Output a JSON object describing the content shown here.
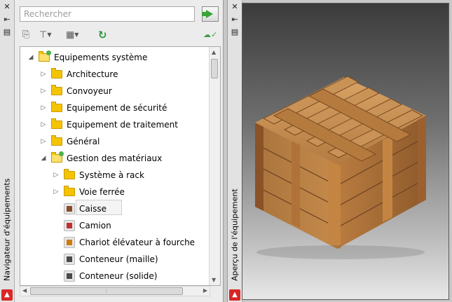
{
  "navigator": {
    "title": "Navigateur d'équipements",
    "search_placeholder": "Rechercher",
    "tree": [
      {
        "label": "Equipements système",
        "kind": "folder-open",
        "expander": "◢",
        "level": 0
      },
      {
        "label": "Architecture",
        "kind": "folder",
        "expander": "▷",
        "level": 1
      },
      {
        "label": "Convoyeur",
        "kind": "folder",
        "expander": "▷",
        "level": 1
      },
      {
        "label": "Equipement de sécurité",
        "kind": "folder",
        "expander": "▷",
        "level": 1
      },
      {
        "label": "Equipement de traitement",
        "kind": "folder",
        "expander": "▷",
        "level": 1
      },
      {
        "label": "Général",
        "kind": "folder",
        "expander": "▷",
        "level": 1
      },
      {
        "label": "Gestion des matériaux",
        "kind": "folder-open",
        "expander": "◢",
        "level": 1
      },
      {
        "label": "Système à rack",
        "kind": "folder",
        "expander": "▷",
        "level": 2
      },
      {
        "label": "Voie ferrée",
        "kind": "folder",
        "expander": "▷",
        "level": 2
      },
      {
        "label": "Caisse",
        "kind": "item",
        "icon_color": "#8a4a2a",
        "level": 2,
        "selected": true
      },
      {
        "label": "Camion",
        "kind": "item",
        "icon_color": "#c03030",
        "level": 2
      },
      {
        "label": "Chariot élévateur à fourche",
        "kind": "item",
        "icon_color": "#d07a10",
        "level": 2
      },
      {
        "label": "Conteneur (maille)",
        "kind": "item",
        "icon_color": "#4a4a4a",
        "level": 2
      },
      {
        "label": "Conteneur (solide)",
        "kind": "item",
        "icon_color": "#4a4a4a",
        "level": 2
      }
    ]
  },
  "preview": {
    "title": "Aperçu de l'équipement"
  }
}
